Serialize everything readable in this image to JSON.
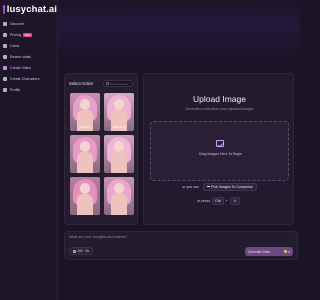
{
  "brand": {
    "name": "lusychat.ai"
  },
  "sidebar": {
    "items": [
      {
        "label": "Discover",
        "icon": "compass-icon",
        "active": false
      },
      {
        "label": "Pricing",
        "icon": "tag-icon",
        "badge": "Sale",
        "active": false
      },
      {
        "label": "Cams",
        "icon": "camera-icon",
        "active": false
      },
      {
        "label": "Recent chats",
        "icon": "chat-icon",
        "active": false
      },
      {
        "label": "Create Video",
        "icon": "video-icon",
        "active": true
      },
      {
        "label": "Create Characters",
        "icon": "plus-icon",
        "active": false
      },
      {
        "label": "Profile",
        "icon": "user-icon",
        "active": false
      }
    ]
  },
  "select_action": {
    "title": "Select Action",
    "search_placeholder": "Search action",
    "actions": [
      {
        "label": "Flirting",
        "hair_color": "#e5a1c9",
        "bg": "#c98fb2"
      },
      {
        "label": "Seducing",
        "hair_color": "#f0b2d3",
        "bg": "#d9a9c3"
      },
      {
        "label": "",
        "hair_color": "#e79ac8",
        "bg": "#c78daf"
      },
      {
        "label": "",
        "hair_color": "#f1b5d6",
        "bg": "#d2a3bf"
      },
      {
        "label": "",
        "hair_color": "#e38fc0",
        "bg": "#b67f9f"
      },
      {
        "label": "",
        "hair_color": "#eaa7cf",
        "bg": "#c897b3"
      }
    ]
  },
  "upload": {
    "title": "Upload Image",
    "subtitle": "Generate a video from your uploaded images",
    "dropzone_text": "Drag Images Here To Begin",
    "or_text": "or you can",
    "pick_button": "Pick Images To Compress",
    "press_text": "or press",
    "key_ctrl": "Ctrl",
    "key_plus": "+",
    "key_v": "V"
  },
  "prompt": {
    "placeholder": "What are your thoughts and wishes?",
    "model": "480 - 5s",
    "generate_label": "Generate Video",
    "cost": "0"
  }
}
